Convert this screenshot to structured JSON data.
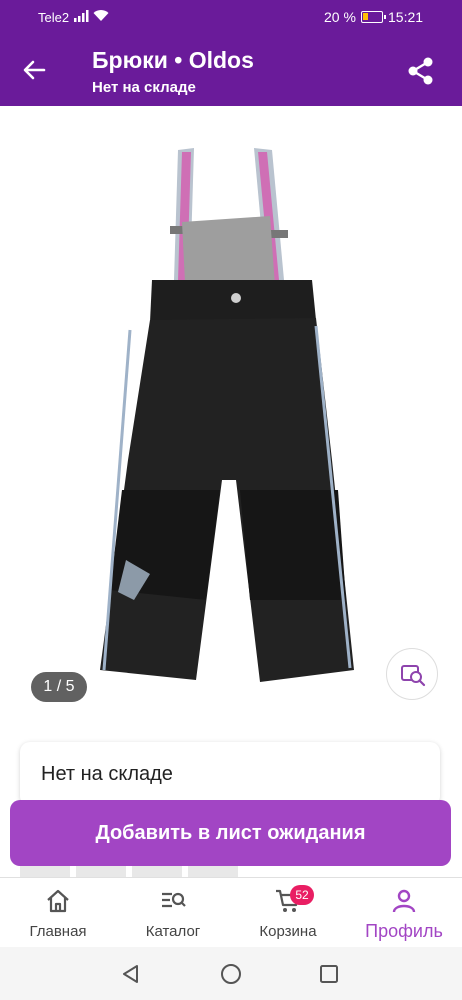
{
  "status_bar": {
    "carrier": "Tele2",
    "battery_percent": "20 %",
    "time": "15:21"
  },
  "header": {
    "title": "Брюки • Oldos",
    "subtitle": "Нет на складе",
    "back_icon": "arrow-left-icon",
    "share_icon": "share-icon"
  },
  "gallery": {
    "counter": "1 / 5",
    "zoom_icon": "image-search-icon"
  },
  "stock_status": {
    "text": "Нет на складе"
  },
  "actions": {
    "waitlist_label": "Добавить в лист ожидания"
  },
  "bottom_nav": {
    "items": [
      {
        "label": "Главная",
        "icon": "home-icon"
      },
      {
        "label": "Каталог",
        "icon": "catalog-search-icon"
      },
      {
        "label": "Корзина",
        "icon": "cart-icon",
        "badge": "52"
      },
      {
        "label": "Профиль",
        "icon": "profile-icon",
        "active": true
      }
    ]
  },
  "colors": {
    "brand": "#6a1b9a",
    "accent": "#a245c4",
    "badge": "#e91e63"
  }
}
